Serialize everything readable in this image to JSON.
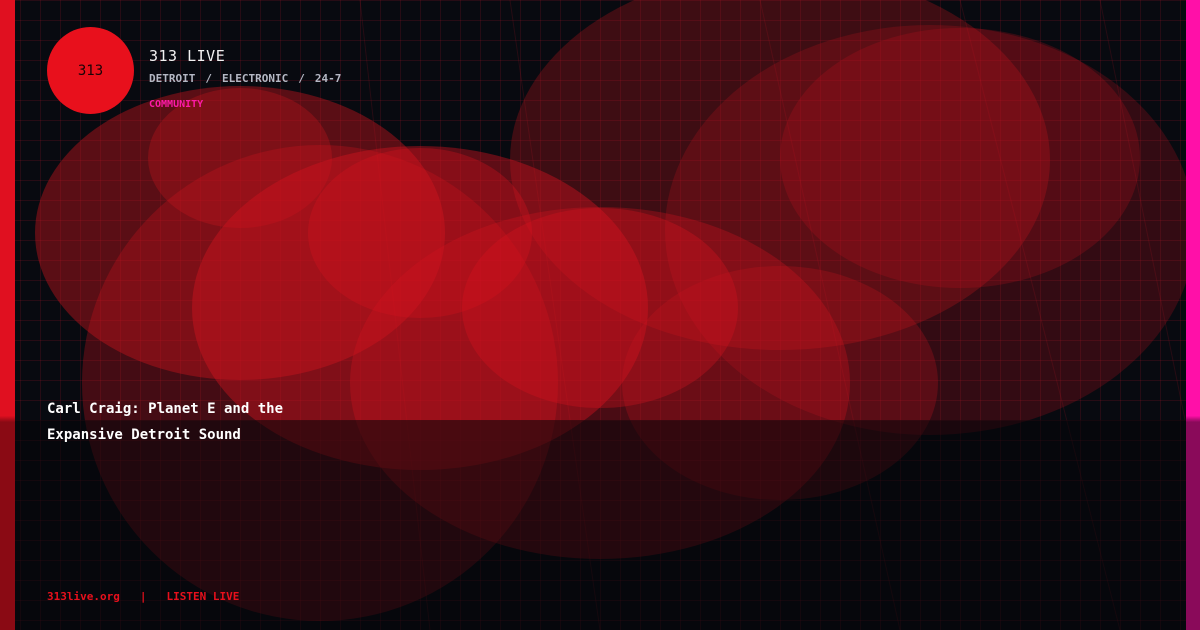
{
  "logo": {
    "text": "313"
  },
  "brand": {
    "title": "313 LIVE"
  },
  "tags": {
    "city": "DETROIT",
    "separator": "/",
    "genre": "ELECTRONIC",
    "schedule": "24-7"
  },
  "category": {
    "label": "COMMUNITY"
  },
  "headline": {
    "line1": "Carl Craig: Planet E and the",
    "line2": "Expansive Detroit Sound"
  },
  "footer": {
    "site": "313live.org",
    "divider": "|",
    "cta": "LISTEN LIVE"
  },
  "colors": {
    "background": "#080a10",
    "accent_red": "#e8101c",
    "accent_pink": "#ff10a8",
    "grid": "#961428"
  }
}
